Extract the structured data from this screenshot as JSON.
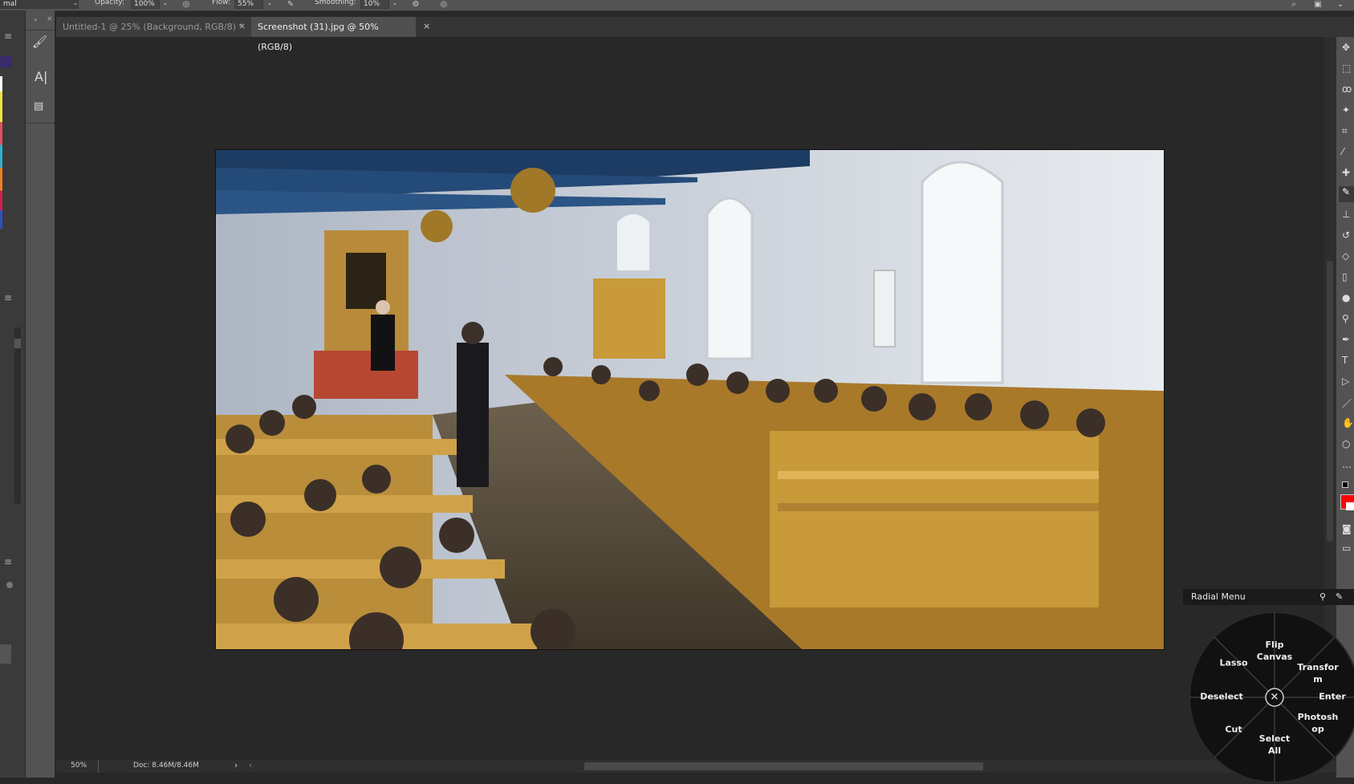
{
  "options_bar": {
    "mode_value": "mal",
    "opacity_label": "Opacity:",
    "opacity_value": "100%",
    "flow_label": "Flow:",
    "flow_value": "55%",
    "smoothing_label": "Smoothing:",
    "smoothing_value": "10%"
  },
  "tabs": [
    {
      "label": "Untitled-1 @ 25% (Background, RGB/8) *",
      "close": "×"
    },
    {
      "label": "Screenshot (31).jpg @ 50% (RGB/8)",
      "close": "×"
    }
  ],
  "left_tools": {
    "text_tool": "A|"
  },
  "status_bar": {
    "zoom": "50%",
    "doc_info": "Doc: 8.46M/8.46M",
    "next_arrow": "›",
    "prev_arrow": "‹"
  },
  "radial_menu": {
    "title": "Radial Menu",
    "items": {
      "flip_canvas": "Flip\nCanvas",
      "transform": "Transfor\nm",
      "enter": "Enter",
      "photoshop": "Photosh\nop",
      "select_all": "Select\nAll",
      "cut": "Cut",
      "deselect": "Deselect",
      "lasso": "Lasso",
      "close": "✕"
    }
  },
  "colors": {
    "foreground": "#ff0000",
    "background": "#ffffff",
    "swatches": [
      "#3a2a6a",
      "#ffffff",
      "#f0e040",
      "#e05060",
      "#30b0d0",
      "#f08020",
      "#d02050",
      "#3050c0"
    ]
  }
}
